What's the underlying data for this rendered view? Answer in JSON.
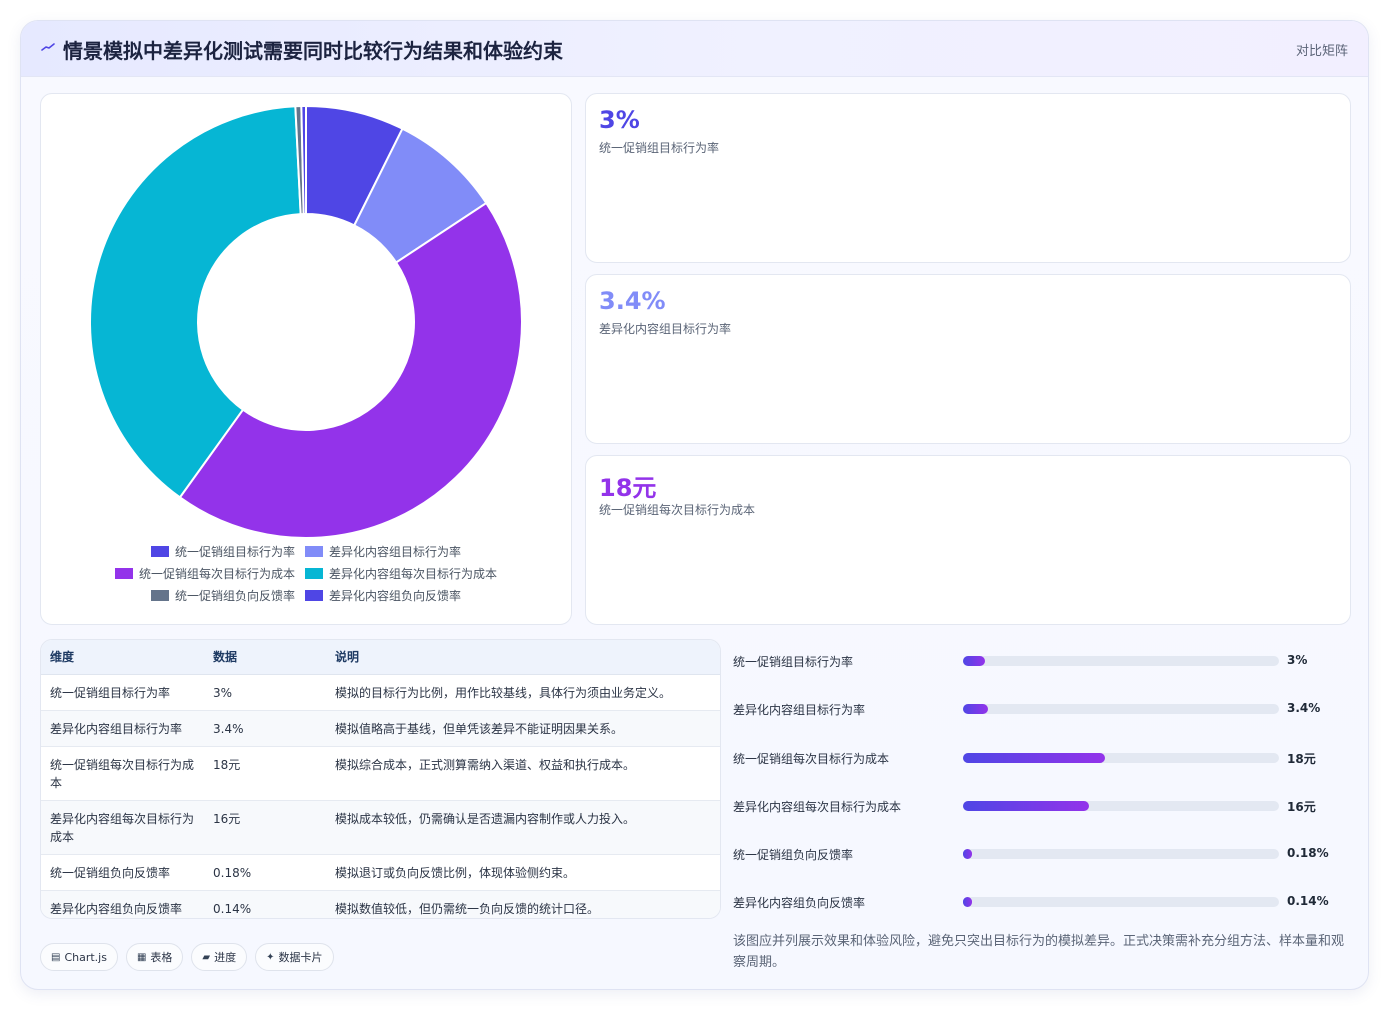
{
  "header": {
    "title": "情景模拟中差异化测试需要同时比较行为结果和体验约束",
    "tag": "对比矩阵"
  },
  "kpis": [
    {
      "value": "3%",
      "label": "统一促销组目标行为率",
      "color": "#4f46e5"
    },
    {
      "value": "3.4%",
      "label": "差异化内容组目标行为率",
      "color": "#818cf8"
    },
    {
      "value": "18元",
      "label": "统一促销组每次目标行为成本",
      "color": "#9333ea"
    }
  ],
  "chart_data": {
    "type": "pie",
    "variant": "doughnut",
    "labels": [
      "统一促销组目标行为率",
      "差异化内容组目标行为率",
      "统一促销组每次目标行为成本",
      "差异化内容组每次目标行为成本",
      "统一促销组负向反馈率",
      "差异化内容组负向反馈率"
    ],
    "values": [
      3,
      3.4,
      18,
      16,
      0.18,
      0.14
    ],
    "colors": [
      "#4f46e5",
      "#818cf8",
      "#9333ea",
      "#06b6d4",
      "#64748b",
      "#4f46e5"
    ],
    "legend_position": "bottom"
  },
  "table": {
    "headers": [
      "维度",
      "数据",
      "说明"
    ],
    "rows": [
      [
        "统一促销组目标行为率",
        "3%",
        "模拟的目标行为比例，用作比较基线，具体行为须由业务定义。"
      ],
      [
        "差异化内容组目标行为率",
        "3.4%",
        "模拟值略高于基线，但单凭该差异不能证明因果关系。"
      ],
      [
        "统一促销组每次目标行为成本",
        "18元",
        "模拟综合成本，正式测算需纳入渠道、权益和执行成本。"
      ],
      [
        "差异化内容组每次目标行为成本",
        "16元",
        "模拟成本较低，仍需确认是否遗漏内容制作或人力投入。"
      ],
      [
        "统一促销组负向反馈率",
        "0.18%",
        "模拟退订或负向反馈比例，体现体验侧约束。"
      ],
      [
        "差异化内容组负向反馈率",
        "0.14%",
        "模拟数值较低，但仍需统一负向反馈的统计口径。"
      ]
    ]
  },
  "progress": [
    {
      "label": "统一促销组目标行为率",
      "value": "3%",
      "fraction": 0.07
    },
    {
      "label": "差异化内容组目标行为率",
      "value": "3.4%",
      "fraction": 0.08
    },
    {
      "label": "统一促销组每次目标行为成本",
      "value": "18元",
      "fraction": 0.45
    },
    {
      "label": "差异化内容组每次目标行为成本",
      "value": "16元",
      "fraction": 0.4
    },
    {
      "label": "统一促销组负向反馈率",
      "value": "0.18%",
      "fraction": 0.03
    },
    {
      "label": "差异化内容组负向反馈率",
      "value": "0.14%",
      "fraction": 0.03
    }
  ],
  "chips": [
    {
      "icon": "chart-icon",
      "glyph": "▤",
      "label": "Chart.js"
    },
    {
      "icon": "table-icon",
      "glyph": "▦",
      "label": "表格"
    },
    {
      "icon": "progress-icon",
      "glyph": "▰",
      "label": "进度"
    },
    {
      "icon": "card-icon",
      "glyph": "✦",
      "label": "数据卡片"
    }
  ],
  "note": "该图应并列展示效果和体验风险，避免只突出目标行为的模拟差异。正式决策需补充分组方法、样本量和观察周期。"
}
